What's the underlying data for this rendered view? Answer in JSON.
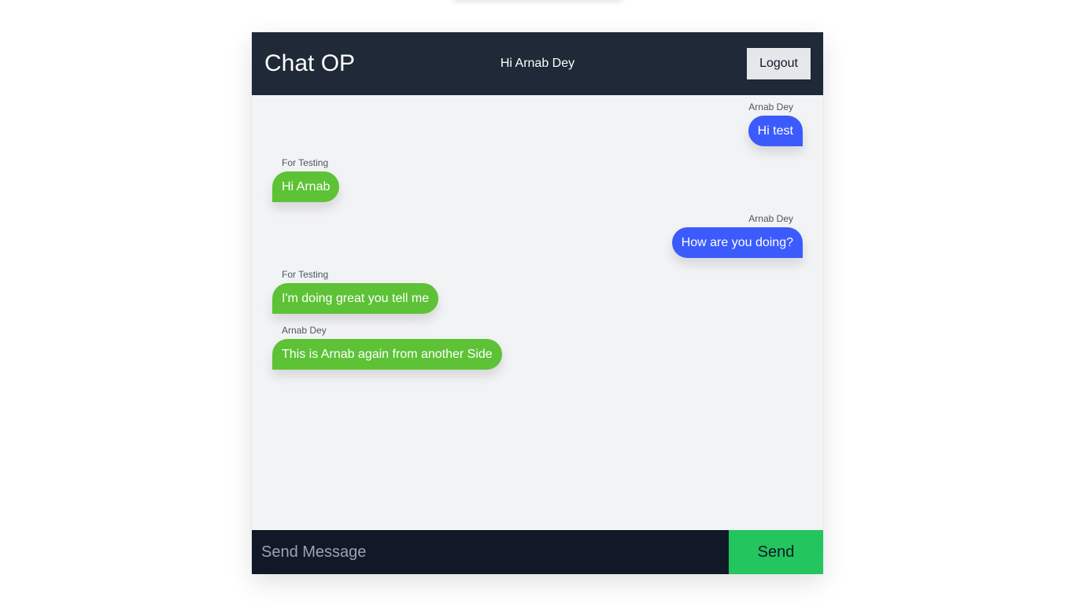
{
  "header": {
    "title": "Chat OP",
    "greeting": "Hi Arnab Dey",
    "logout_label": "Logout"
  },
  "messages": [
    {
      "sender": "Arnab Dey",
      "text": "Hi test",
      "side": "right"
    },
    {
      "sender": "For Testing",
      "text": "Hi Arnab",
      "side": "left"
    },
    {
      "sender": "Arnab Dey",
      "text": "How are you doing?",
      "side": "right"
    },
    {
      "sender": "For Testing",
      "text": "I'm doing great you tell me",
      "side": "left"
    },
    {
      "sender": "Arnab Dey",
      "text": "This is Arnab again from another Side",
      "side": "left"
    }
  ],
  "composer": {
    "placeholder": "Send Message",
    "value": "",
    "send_label": "Send"
  },
  "colors": {
    "header_bg": "#1f2937",
    "own_bubble": "#3b5bfd",
    "other_bubble": "#5dc236",
    "send_button": "#22c55e",
    "input_bg": "#111827"
  }
}
